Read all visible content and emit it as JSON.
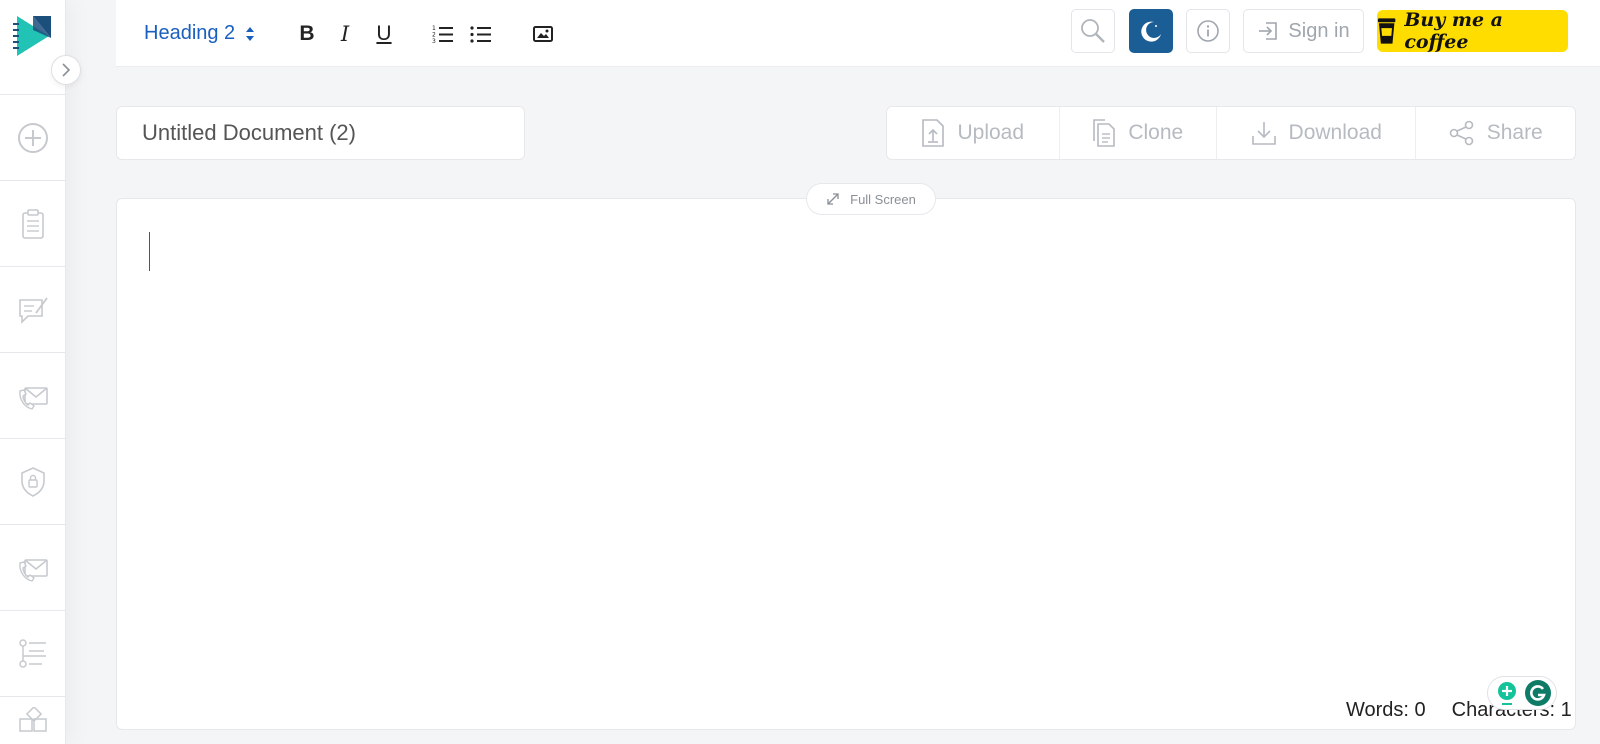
{
  "toolbar": {
    "block_format": "Heading 2",
    "bold_label": "B",
    "italic_label": "I",
    "underline_label": "U"
  },
  "header": {
    "signin_label": "Sign in",
    "coffee_label": "Buy me a coffee"
  },
  "document": {
    "title": "Untitled Document (2)"
  },
  "actions": {
    "upload": "Upload",
    "clone": "Clone",
    "download": "Download",
    "share": "Share"
  },
  "editor": {
    "fullscreen_label": "Full Screen",
    "words": "Words: 0",
    "characters": "Characters: 1"
  },
  "sidebar": {
    "items": [
      "plus-circle-icon",
      "clipboard-icon",
      "comment-edit-icon",
      "phone-mail-icon",
      "shield-lock-icon",
      "phone-mail-icon",
      "list-tree-icon",
      "puzzle-icon"
    ]
  },
  "colors": {
    "accent": "#1a5fbf",
    "dark_mode": "#1b5e96",
    "coffee": "#ffdd00",
    "logo_teal": "#20c3b4",
    "logo_navy": "#1d4f7c",
    "grammarly": "#15c39a"
  }
}
